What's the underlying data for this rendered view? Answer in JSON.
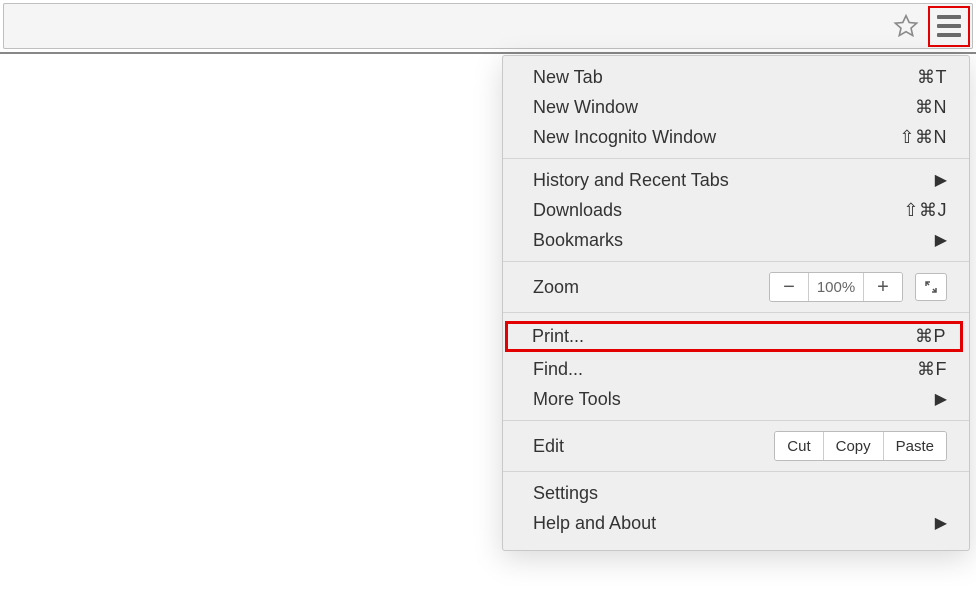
{
  "menu": {
    "group1": [
      {
        "label": "New Tab",
        "shortcut": "⌘T"
      },
      {
        "label": "New Window",
        "shortcut": "⌘N"
      },
      {
        "label": "New Incognito Window",
        "shortcut": "⇧⌘N"
      }
    ],
    "group2": [
      {
        "label": "History and Recent Tabs",
        "submenu": true
      },
      {
        "label": "Downloads",
        "shortcut": "⇧⌘J"
      },
      {
        "label": "Bookmarks",
        "submenu": true
      }
    ],
    "zoom": {
      "label": "Zoom",
      "value": "100%",
      "minus": "−",
      "plus": "+"
    },
    "group4": [
      {
        "label": "Print...",
        "shortcut": "⌘P",
        "highlight": true
      },
      {
        "label": "Find...",
        "shortcut": "⌘F"
      },
      {
        "label": "More Tools",
        "submenu": true
      }
    ],
    "edit": {
      "label": "Edit",
      "cut": "Cut",
      "copy": "Copy",
      "paste": "Paste"
    },
    "group6": [
      {
        "label": "Settings"
      },
      {
        "label": "Help and About",
        "submenu": true
      }
    ]
  }
}
